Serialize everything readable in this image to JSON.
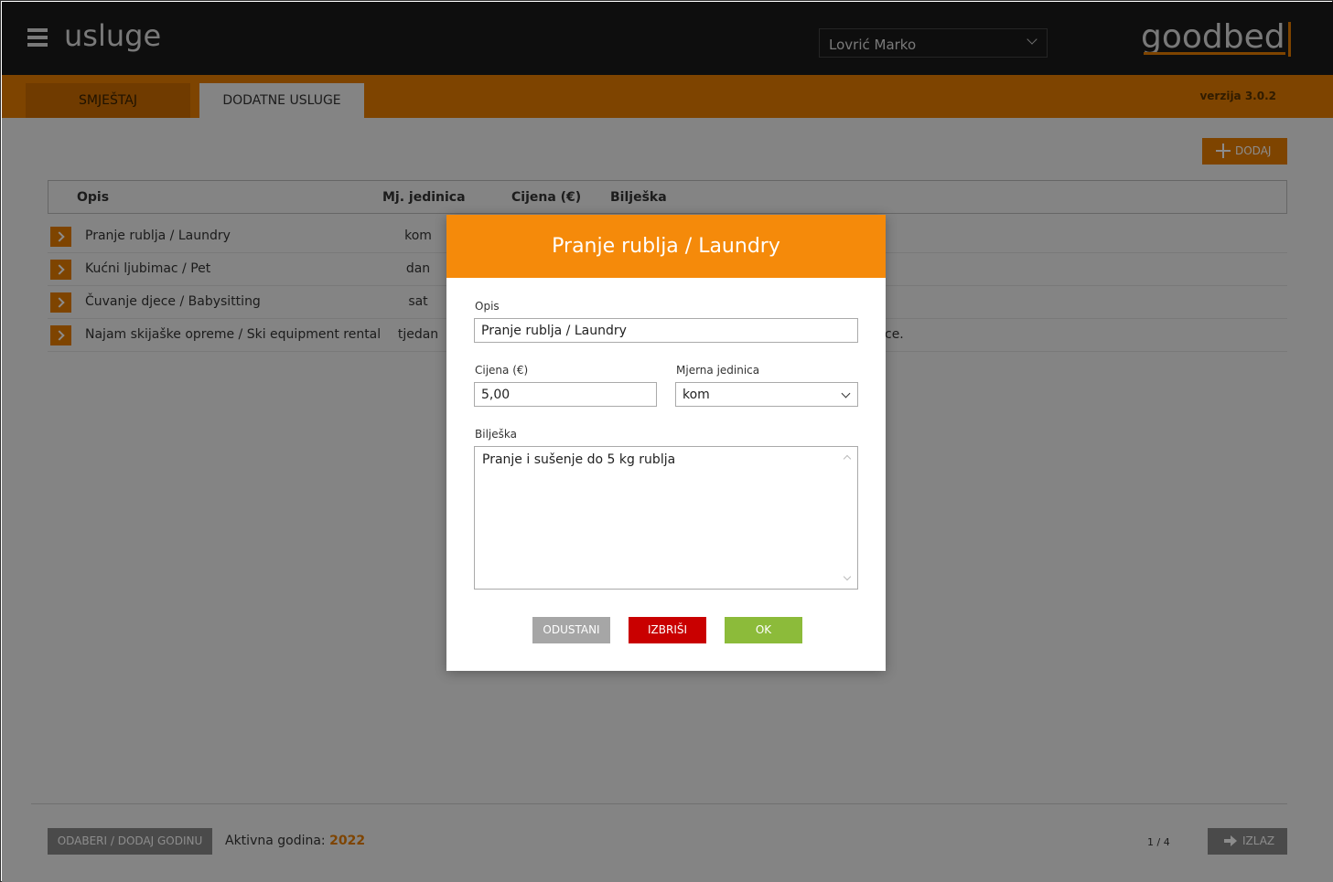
{
  "header": {
    "title": "usluge",
    "user": "Lovrić Marko",
    "logo": "goodbed"
  },
  "tabs": [
    {
      "label": "SMJEŠTAJ"
    },
    {
      "label": "DODATNE USLUGE"
    }
  ],
  "version": "verzija 3.0.2",
  "toolbar": {
    "add_label": "DODAJ"
  },
  "table": {
    "columns": [
      "Opis",
      "Mj. jedinica",
      "Cijena (€)",
      "Bilješka"
    ],
    "rows": [
      {
        "opis": "Pranje rublja / Laundry",
        "mj": "kom",
        "note": ""
      },
      {
        "opis": "Kućni ljubimac / Pet",
        "mj": "dan",
        "note": ""
      },
      {
        "opis": "Čuvanje djece / Babysitting",
        "mj": "sat",
        "note": ""
      },
      {
        "opis": "Najam skijaške opreme / Ski equipment rental",
        "mj": "tjedan",
        "note": "ce."
      }
    ]
  },
  "footer": {
    "year_button": "ODABERI / DODAJ GODINU",
    "active_year_label": "Aktivna godina:",
    "active_year": "2022",
    "pager": "1 / 4",
    "exit_label": "IZLAZ"
  },
  "modal": {
    "title": "Pranje rublja / Laundry",
    "opis_label": "Opis",
    "opis_value": "Pranje rublja / Laundry",
    "cijena_label": "Cijena (€)",
    "cijena_value": "5,00",
    "mj_label": "Mjerna jedinica",
    "mj_value": "kom",
    "note_label": "Bilješka",
    "note_value": "Pranje i sušenje do 5 kg rublja",
    "cancel": "ODUSTANI",
    "delete": "IZBRIŠI",
    "ok": "OK"
  },
  "colors": {
    "accent": "#e57c00",
    "modal_header": "#f58a0a",
    "delete": "#c90000",
    "ok": "#8cbb3a"
  }
}
